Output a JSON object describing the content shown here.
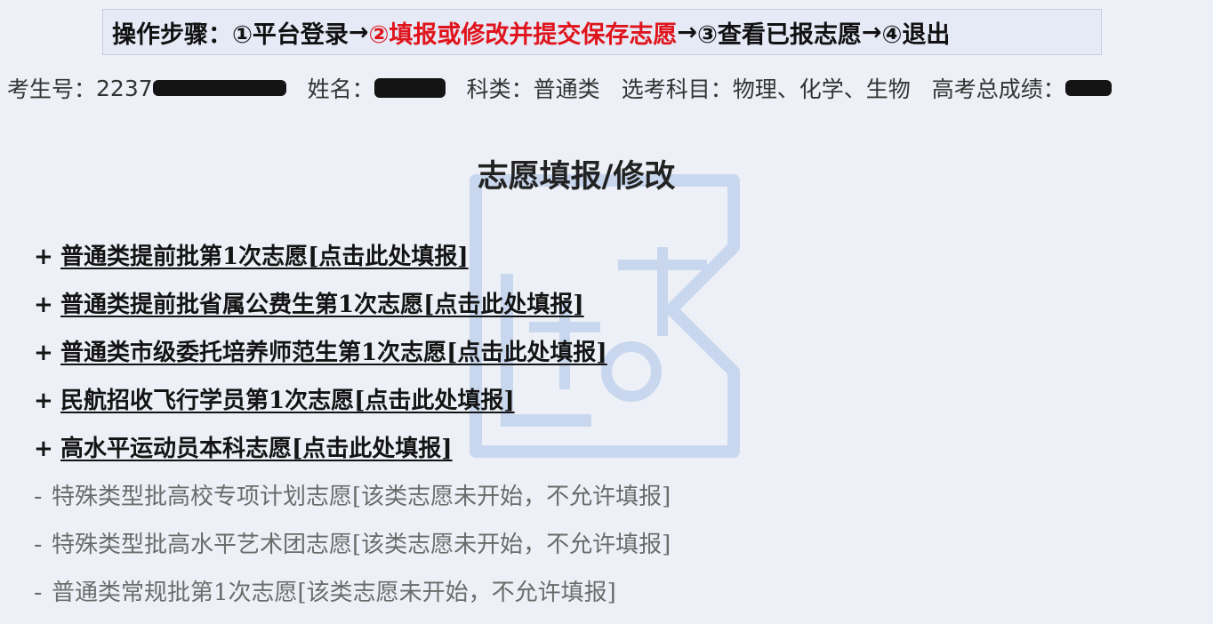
{
  "steps": {
    "label": "操作步骤：",
    "step1": "①平台登录",
    "step2": "②填报或修改并提交保存志愿",
    "step3": "③查看已报志愿",
    "step4": "④退出",
    "arrow": "→",
    "active_color": "#e0141c"
  },
  "info": {
    "exam_no_label": "考生号：",
    "exam_no_visible": "2237",
    "name_label": "姓名：",
    "category_label": "科类：",
    "category_value": "普通类",
    "subjects_label": "选考科目：",
    "subjects_value": "物理、化学、生物",
    "score_label": "高考总成绩："
  },
  "title": "志愿填报/修改",
  "open_items": [
    {
      "prefix": "+",
      "label": "普通类提前批第1次志愿[点击此处填报]"
    },
    {
      "prefix": "+",
      "label": "普通类提前批省属公费生第1次志愿[点击此处填报]"
    },
    {
      "prefix": "+",
      "label": "普通类市级委托培养师范生第1次志愿[点击此处填报]"
    },
    {
      "prefix": "+",
      "label": "民航招收飞行学员第1次志愿[点击此处填报]"
    },
    {
      "prefix": "+",
      "label": "高水平运动员本科志愿[点击此处填报]"
    }
  ],
  "closed_items": [
    {
      "prefix": "-",
      "label": "特殊类型批高校专项计划志愿[该类志愿未开始，不允许填报]"
    },
    {
      "prefix": "-",
      "label": "特殊类型批高水平艺术团志愿[该类志愿未开始，不允许填报]"
    },
    {
      "prefix": "-",
      "label": "普通类常规批第1次志愿[该类志愿未开始，不允许填报]"
    }
  ],
  "watermark_color": "#4a7fd0"
}
